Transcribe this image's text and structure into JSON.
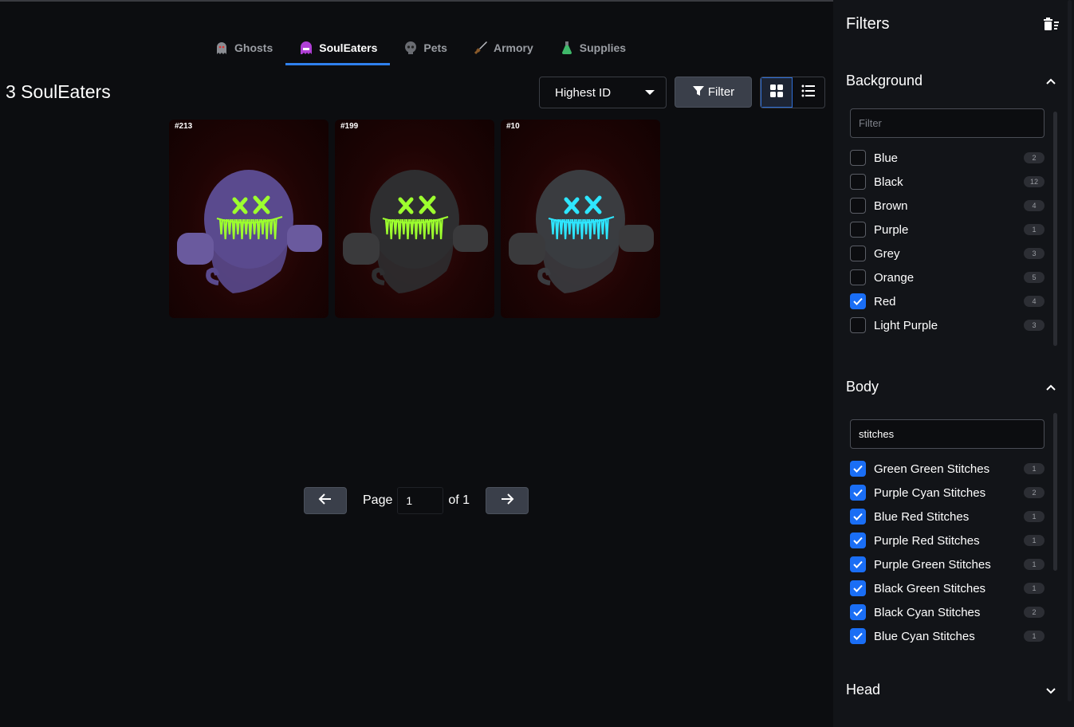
{
  "tabs": [
    {
      "label": "Ghosts",
      "icon": "ghost-icon"
    },
    {
      "label": "SoulEaters",
      "icon": "souleater-icon",
      "active": true
    },
    {
      "label": "Pets",
      "icon": "pet-icon"
    },
    {
      "label": "Armory",
      "icon": "sword-icon"
    },
    {
      "label": "Supplies",
      "icon": "potion-icon"
    }
  ],
  "title": "3 SoulEaters",
  "sort": {
    "selected": "Highest ID"
  },
  "filter_button": {
    "label": "Filter"
  },
  "cards": [
    {
      "id": "#213",
      "body_color": "#5a4a8e",
      "hand_color": "#6a5a9e",
      "face_color": "#9dff2e"
    },
    {
      "id": "#199",
      "body_color": "#2e2e30",
      "hand_color": "#3a3a3c",
      "face_color": "#9dff2e"
    },
    {
      "id": "#10",
      "body_color": "#3a3c40",
      "hand_color": "#3a3a3c",
      "face_color": "#2ee6ff"
    }
  ],
  "pagination": {
    "page_label": "Page",
    "page_value": "1",
    "of_label": "of 1"
  },
  "sidebar": {
    "title": "Filters",
    "background": {
      "title": "Background",
      "search_placeholder": "Filter",
      "options": [
        {
          "label": "Blue",
          "count": "2",
          "checked": false
        },
        {
          "label": "Black",
          "count": "12",
          "checked": false
        },
        {
          "label": "Brown",
          "count": "4",
          "checked": false
        },
        {
          "label": "Purple",
          "count": "1",
          "checked": false
        },
        {
          "label": "Grey",
          "count": "3",
          "checked": false
        },
        {
          "label": "Orange",
          "count": "5",
          "checked": false
        },
        {
          "label": "Red",
          "count": "4",
          "checked": true
        },
        {
          "label": "Light Purple",
          "count": "3",
          "checked": false
        }
      ]
    },
    "body": {
      "title": "Body",
      "search_value": "stitches",
      "options": [
        {
          "label": "Green Green Stitches",
          "count": "1",
          "checked": true
        },
        {
          "label": "Purple Cyan Stitches",
          "count": "2",
          "checked": true
        },
        {
          "label": "Blue Red Stitches",
          "count": "1",
          "checked": true
        },
        {
          "label": "Purple Red Stitches",
          "count": "1",
          "checked": true
        },
        {
          "label": "Purple Green Stitches",
          "count": "1",
          "checked": true
        },
        {
          "label": "Black Green Stitches",
          "count": "1",
          "checked": true
        },
        {
          "label": "Black Cyan Stitches",
          "count": "2",
          "checked": true
        },
        {
          "label": "Blue Cyan Stitches",
          "count": "1",
          "checked": true
        }
      ]
    },
    "head": {
      "title": "Head"
    }
  },
  "colors": {
    "accent": "#2f80ed",
    "checkbox": "#1a6ef5"
  }
}
